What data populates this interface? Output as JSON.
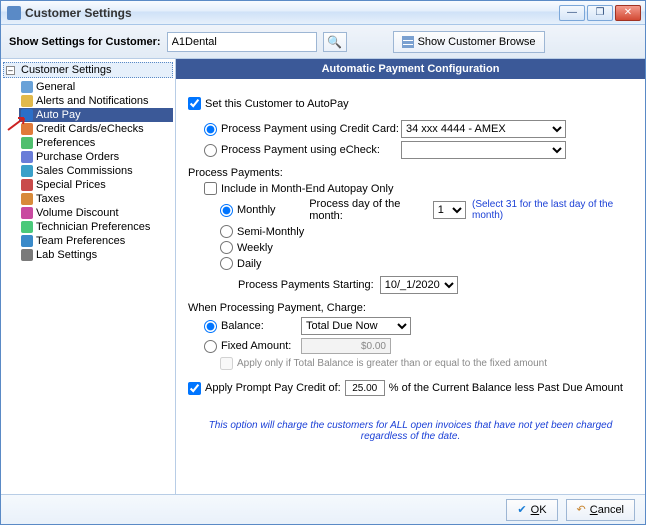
{
  "window": {
    "title": "Customer Settings",
    "min_label": "—",
    "max_label": "❐",
    "close_label": "✕"
  },
  "toolbar": {
    "show_settings_label": "Show Settings for Customer:",
    "customer_value": "A1Dental",
    "search_icon": "🔍",
    "browse_label": "Show Customer Browse"
  },
  "tree": {
    "root": "Customer Settings",
    "items": [
      {
        "label": "General",
        "color": "#6aa2d8"
      },
      {
        "label": "Alerts and Notifications",
        "color": "#e2b94a"
      },
      {
        "label": "Auto Pay",
        "color": "#2a6fc9",
        "selected": true
      },
      {
        "label": "Credit Cards/eChecks",
        "color": "#e07a3a"
      },
      {
        "label": "Preferences",
        "color": "#4fbf6e"
      },
      {
        "label": "Purchase Orders",
        "color": "#6a7dd8"
      },
      {
        "label": "Sales Commissions",
        "color": "#3aa0c9"
      },
      {
        "label": "Special Prices",
        "color": "#c94a4a"
      },
      {
        "label": "Taxes",
        "color": "#d88a3a"
      },
      {
        "label": "Volume Discount",
        "color": "#c94aa0"
      },
      {
        "label": "Technician Preferences",
        "color": "#4ac97a"
      },
      {
        "label": "Team Preferences",
        "color": "#3a8ac9"
      },
      {
        "label": "Lab Settings",
        "color": "#7a7a7a"
      }
    ]
  },
  "panel": {
    "title": "Automatic Payment Configuration",
    "set_autopay_label": "Set this Customer to AutoPay",
    "set_autopay_checked": true,
    "method": {
      "cc_label": "Process Payment using Credit Card:",
      "cc_selected": "34 xxx 4444 - AMEX",
      "echeck_label": "Process Payment using eCheck:",
      "method_choice": "cc"
    },
    "process_section_label": "Process Payments:",
    "include_month_end_label": "Include in Month-End Autopay Only",
    "include_month_end_checked": false,
    "freq": {
      "monthly": "Monthly",
      "semi_monthly": "Semi-Monthly",
      "weekly": "Weekly",
      "daily": "Daily",
      "selected": "monthly"
    },
    "process_day_label": "Process day of the month:",
    "process_day_value": "1",
    "process_day_hint": "(Select 31 for the last day of the month)",
    "process_start_label": "Process Payments Starting:",
    "process_start_value": "10/_1/2020",
    "charge_section_label": "When Processing Payment, Charge:",
    "charge": {
      "balance_label": "Balance:",
      "balance_value": "Total Due Now",
      "fixed_label": "Fixed Amount:",
      "fixed_value": "$0.00",
      "selected": "balance",
      "apply_only_label": "Apply only if Total Balance is greater than or equal to the fixed amount"
    },
    "prompt_pay": {
      "checked": true,
      "label_pre": "Apply Prompt Pay Credit of:",
      "value": "25.00",
      "label_post": "% of the Current Balance less Past Due Amount"
    },
    "footer_note": "This option will charge the customers for ALL open invoices that have not yet been charged regardless of the date."
  },
  "footer": {
    "ok_label": "OK",
    "cancel_label": "Cancel"
  }
}
